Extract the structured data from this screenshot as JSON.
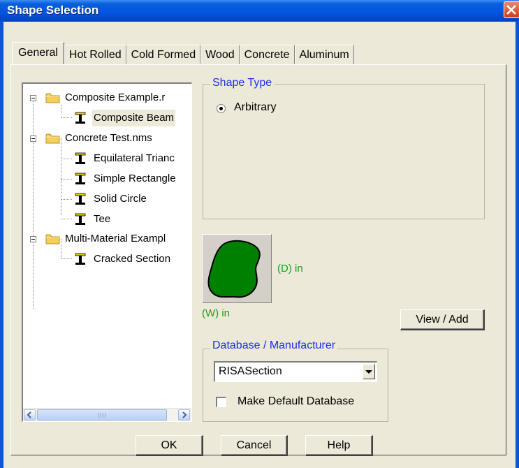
{
  "window": {
    "title": "Shape Selection"
  },
  "tabs": [
    {
      "label": "General"
    },
    {
      "label": "Hot Rolled"
    },
    {
      "label": "Cold Formed"
    },
    {
      "label": "Wood"
    },
    {
      "label": "Concrete"
    },
    {
      "label": "Aluminum"
    }
  ],
  "tree": {
    "items": [
      {
        "label": "Composite Example.r",
        "type": "folder"
      },
      {
        "label": "Composite Beam",
        "type": "shape",
        "selected": true
      },
      {
        "label": "Concrete Test.nms",
        "type": "folder"
      },
      {
        "label": "Equilateral Trianc",
        "type": "shape"
      },
      {
        "label": "Simple Rectangle",
        "type": "shape"
      },
      {
        "label": "Solid Circle",
        "type": "shape"
      },
      {
        "label": "Tee",
        "type": "shape"
      },
      {
        "label": "Multi-Material Exampl",
        "type": "folder"
      },
      {
        "label": "Cracked Section",
        "type": "shape"
      }
    ],
    "scrollbar_grip": "III"
  },
  "shape_type": {
    "title": "Shape Type",
    "option": "Arbitrary",
    "selected": true
  },
  "preview": {
    "depth_label": "(D) in",
    "width_label": "(W) in",
    "fill_color": "#008000"
  },
  "view_add_label": "View / Add",
  "database": {
    "title": "Database / Manufacturer",
    "selected": "RISASection",
    "default_checkbox_label": "Make Default Database",
    "default_checked": false
  },
  "buttons": {
    "ok": "OK",
    "cancel": "Cancel",
    "help": "Help"
  },
  "colors": {
    "title_bar": "#0355e0",
    "group_title": "#1b2ee4",
    "dimension_label": "#18a018"
  }
}
